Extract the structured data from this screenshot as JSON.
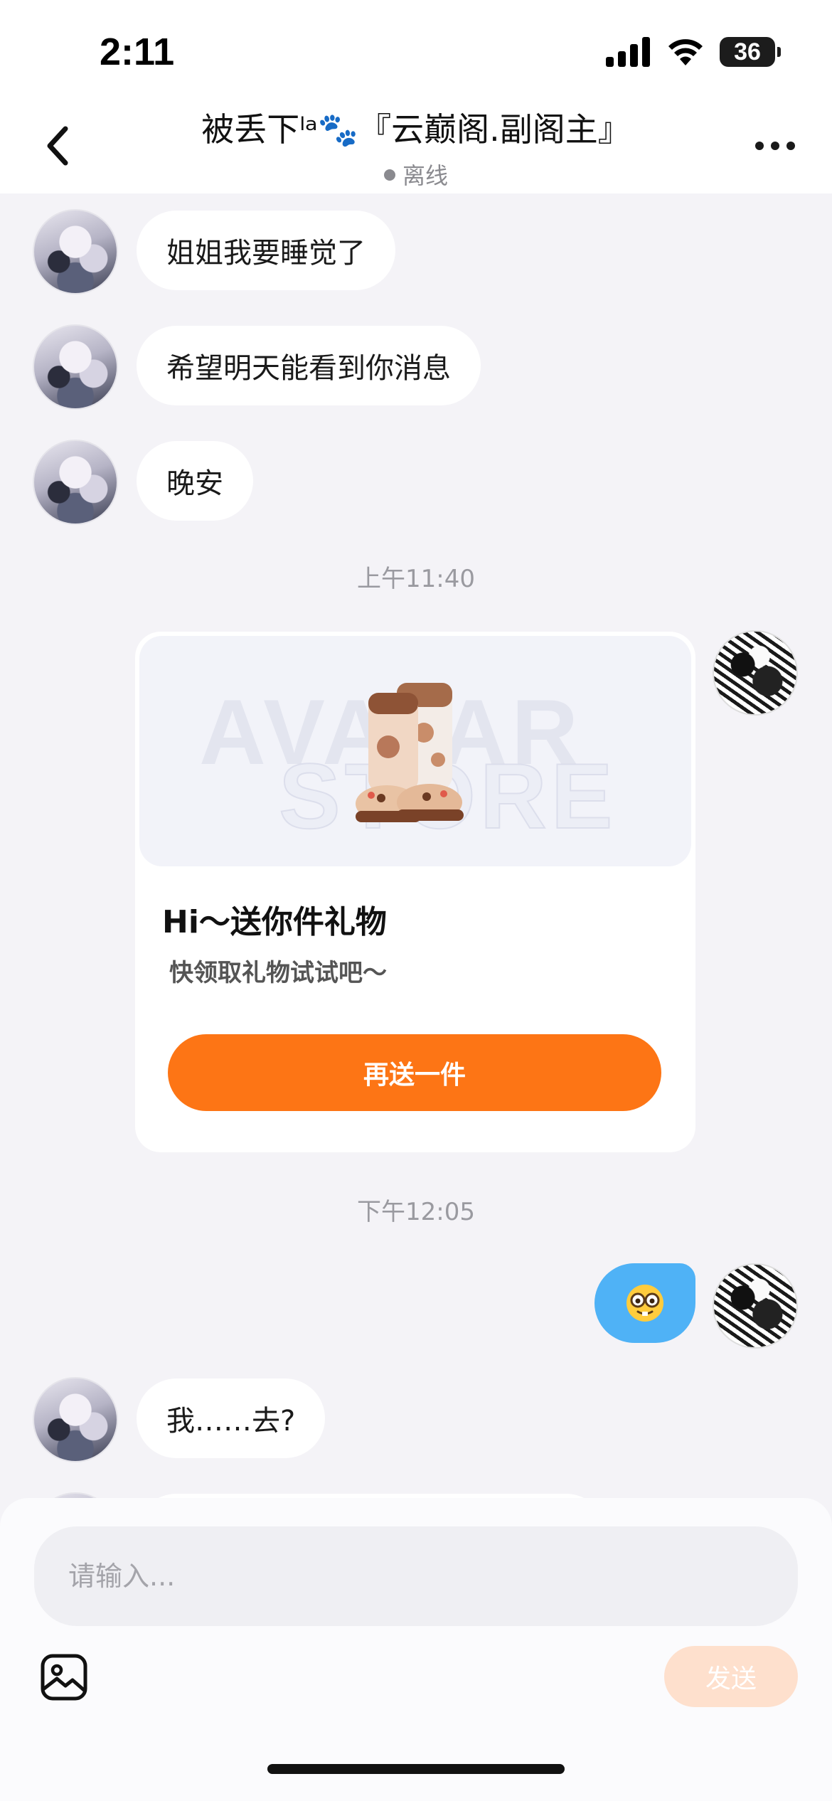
{
  "status_bar": {
    "time": "2:11",
    "battery": "36"
  },
  "header": {
    "title": "被丢下ˡᵃ🐾『云巅阁.副阁主』",
    "status": "离线"
  },
  "messages": [
    {
      "sender": "other",
      "text": "姐姐我要睡觉了"
    },
    {
      "sender": "other",
      "text": "希望明天能看到你消息"
    },
    {
      "sender": "other",
      "text": "晚安"
    },
    {
      "type": "timestamp",
      "text": "上午11:40"
    },
    {
      "sender": "self",
      "type": "gift",
      "watermark_top": "AVATAR",
      "watermark_bottom": "STORE",
      "title": "Hi～送你件礼物",
      "subtitle": "快领取礼物试试吧～",
      "button": "再送一件"
    },
    {
      "type": "timestamp",
      "text": "下午12:05"
    },
    {
      "sender": "self",
      "type": "emoji",
      "icon": "nerd-face-emoji"
    },
    {
      "sender": "other",
      "text": "我……去?"
    }
  ],
  "composer": {
    "placeholder": "请输入...",
    "send_label": "发送"
  },
  "colors": {
    "accent": "#fd7515",
    "self_bubble": "#4fb2f6",
    "send_disabled": "#fee0cd",
    "background": "#f4f3f7"
  }
}
